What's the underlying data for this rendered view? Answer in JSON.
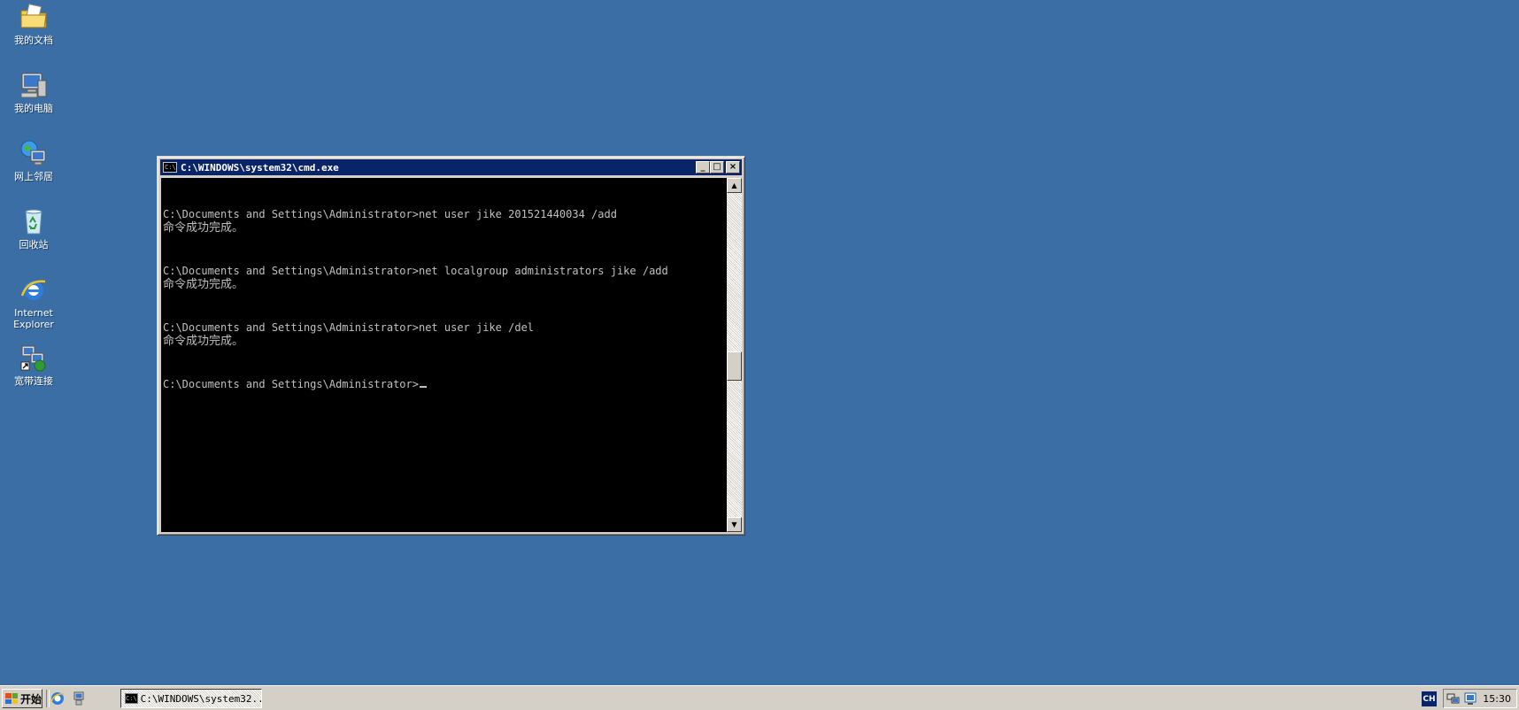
{
  "desktop": {
    "icons": [
      {
        "label": "我的文档",
        "icon": "my-documents-folder-icon"
      },
      {
        "label": "我的电脑",
        "icon": "my-computer-icon"
      },
      {
        "label": "网上邻居",
        "icon": "network-places-icon"
      },
      {
        "label": "回收站",
        "icon": "recycle-bin-icon"
      },
      {
        "label": "Internet\nExplorer",
        "icon": "internet-explorer-icon"
      },
      {
        "label": "宽带连接",
        "icon": "broadband-connection-icon"
      }
    ]
  },
  "cmd_window": {
    "title": "C:\\WINDOWS\\system32\\cmd.exe",
    "icon_text": "C:\\",
    "buttons": {
      "minimize": "_",
      "maximize": "□",
      "close": "×"
    },
    "lines": [
      "C:\\Documents and Settings\\Administrator>net user jike 201521440034 /add",
      "命令成功完成。",
      "C:\\Documents and Settings\\Administrator>net localgroup administrators jike /add",
      "命令成功完成。",
      "C:\\Documents and Settings\\Administrator>net user jike /del",
      "命令成功完成。",
      "C:\\Documents and Settings\\Administrator>"
    ],
    "scrollbar": {
      "up": "▲",
      "down": "▼"
    }
  },
  "taskbar": {
    "start_label": "开始",
    "task_title": "C:\\WINDOWS\\system32...",
    "language": "CH",
    "clock": "15:30"
  },
  "colors": {
    "desktop": "#3a6ea5",
    "titlebar": "#0a246a",
    "console_bg": "#000000",
    "console_text": "#c0c0c0"
  }
}
